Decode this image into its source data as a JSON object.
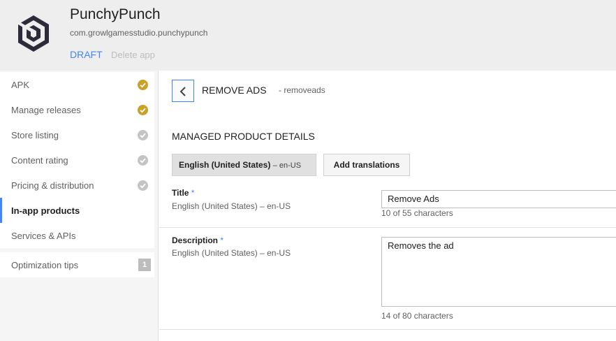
{
  "app": {
    "name": "PunchyPunch",
    "package": "com.growlgamesstudio.punchypunch",
    "status": "DRAFT",
    "delete_label": "Delete app"
  },
  "sidebar": {
    "items": [
      {
        "label": "APK",
        "status": "complete"
      },
      {
        "label": "Manage releases",
        "status": "complete"
      },
      {
        "label": "Store listing",
        "status": "pending"
      },
      {
        "label": "Content rating",
        "status": "pending"
      },
      {
        "label": "Pricing & distribution",
        "status": "pending"
      },
      {
        "label": "In-app products",
        "status": "active"
      },
      {
        "label": "Services & APIs",
        "status": "none"
      }
    ],
    "optimization": {
      "label": "Optimization tips",
      "count": "1"
    }
  },
  "product": {
    "title": "REMOVE ADS",
    "id": "- removeads"
  },
  "details": {
    "section_title": "MANAGED PRODUCT DETAILS",
    "language_tab": {
      "name": "English (United States)",
      "code": "– en-US"
    },
    "add_translations_label": "Add translations",
    "title_field": {
      "label": "Title",
      "required_mark": "*",
      "language": "English (United States) – en-US",
      "value": "Remove Ads",
      "counter": "10 of 55 characters"
    },
    "description_field": {
      "label": "Description",
      "required_mark": "*",
      "language": "English (United States) – en-US",
      "value": "Removes the ad",
      "counter": "14 of 80 characters"
    }
  },
  "colors": {
    "accent": "#4285f4",
    "complete_check": "#c9a227",
    "pending_check": "#c4c4c4"
  }
}
